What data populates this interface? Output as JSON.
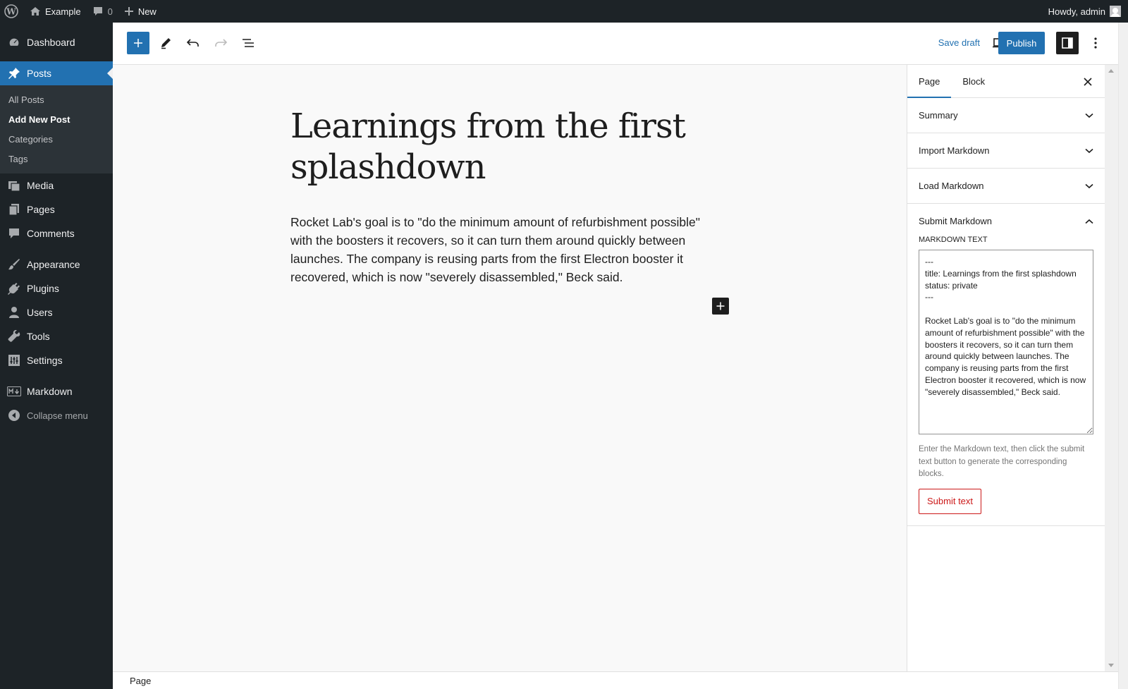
{
  "adminbar": {
    "site_name": "Example",
    "comments_count": "0",
    "new_label": "New",
    "howdy": "Howdy, admin"
  },
  "sidebar": {
    "items": [
      {
        "label": "Dashboard",
        "icon": "dashboard-icon"
      },
      {
        "label": "Posts",
        "icon": "pin-icon"
      },
      {
        "label": "Media",
        "icon": "media-icon"
      },
      {
        "label": "Pages",
        "icon": "pages-icon"
      },
      {
        "label": "Comments",
        "icon": "comment-icon"
      },
      {
        "label": "Appearance",
        "icon": "brush-icon"
      },
      {
        "label": "Plugins",
        "icon": "plugin-icon"
      },
      {
        "label": "Users",
        "icon": "user-icon"
      },
      {
        "label": "Tools",
        "icon": "wrench-icon"
      },
      {
        "label": "Settings",
        "icon": "settings-icon"
      },
      {
        "label": "Markdown",
        "icon": "markdown-icon"
      }
    ],
    "posts_submenu": [
      "All Posts",
      "Add New Post",
      "Categories",
      "Tags"
    ],
    "collapse_label": "Collapse menu"
  },
  "toolbar": {
    "save_draft": "Save draft",
    "publish": "Publish"
  },
  "post": {
    "title": "Learnings from the first splashdown",
    "body": "Rocket Lab's goal is to \"do the minimum amount of refurbishment possible\" with the boosters it recovers, so it can turn them around quickly between launches. The company is reusing parts from the first Electron booster it recovered, which is now \"severely disassembled,\" Beck said."
  },
  "panel": {
    "tabs": [
      "Page",
      "Block"
    ],
    "sections": [
      "Summary",
      "Import Markdown",
      "Load Markdown",
      "Submit Markdown"
    ],
    "markdown_label": "MARKDOWN TEXT",
    "markdown_text": "---\ntitle: Learnings from the first splashdown\nstatus: private\n---\n\nRocket Lab's goal is to \"do the minimum amount of refurbishment possible\" with the boosters it recovers, so it can turn them around quickly between launches. The company is reusing parts from the first Electron booster it recovered, which is now \"severely disassembled,\" Beck said.",
    "help": "Enter the Markdown text, then click the submit text button to generate the corresponding blocks.",
    "submit_label": "Submit text"
  },
  "footer": {
    "breadcrumb": "Page"
  },
  "colors": {
    "accent": "#2271b1",
    "admin_dark": "#1d2327",
    "danger": "#cc1818"
  }
}
